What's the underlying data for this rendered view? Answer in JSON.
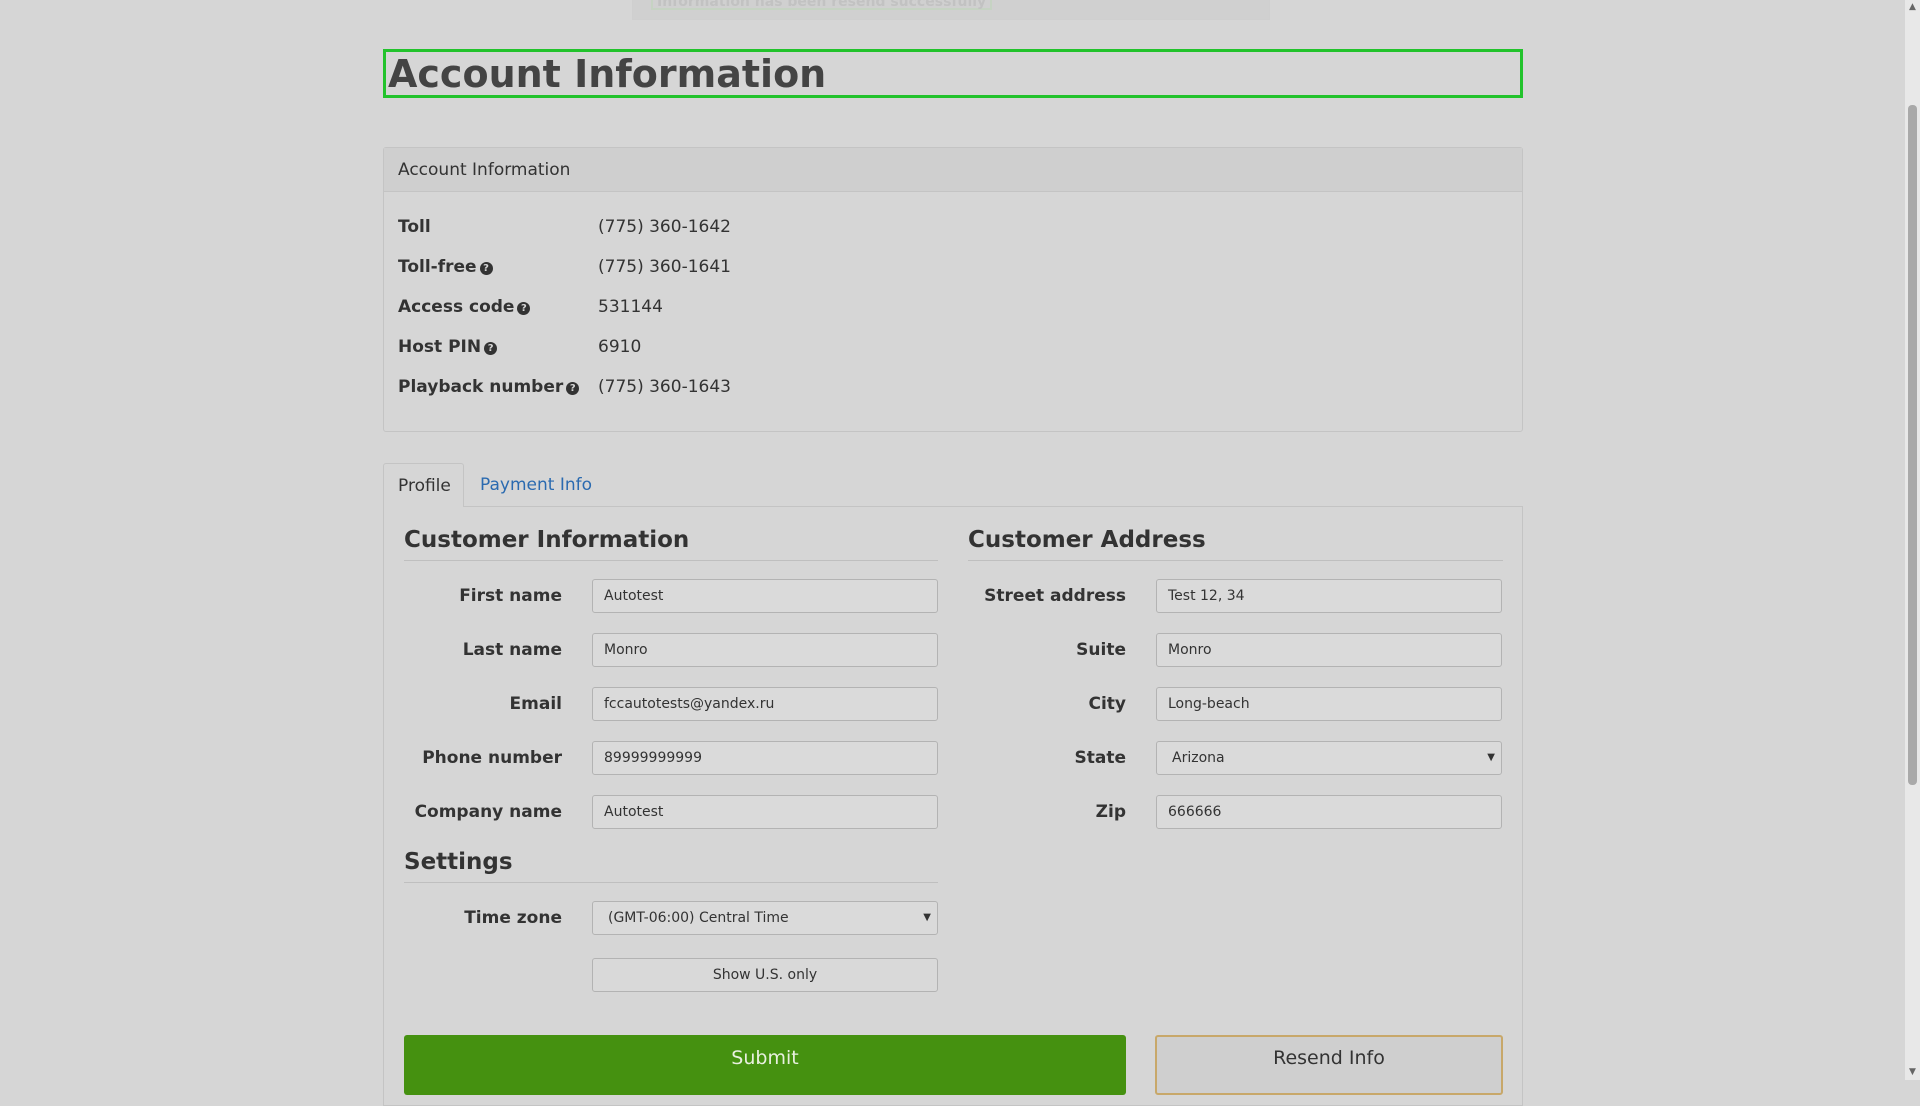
{
  "notification": {
    "text": "Information has been resend successfully"
  },
  "page_title": "Account Information",
  "account_panel": {
    "heading": "Account Information",
    "rows": [
      {
        "label": "Toll",
        "value": "(775) 360-1642",
        "help": false
      },
      {
        "label": "Toll-free",
        "value": "(775) 360-1641",
        "help": true
      },
      {
        "label": "Access code",
        "value": "531144",
        "help": true
      },
      {
        "label": "Host PIN",
        "value": "6910",
        "help": true
      },
      {
        "label": "Playback number",
        "value": "(775) 360-1643",
        "help": true
      }
    ],
    "help_icon": "question-circle-icon"
  },
  "tabs": [
    {
      "label": "Profile",
      "active": true
    },
    {
      "label": "Payment Info",
      "active": false
    }
  ],
  "customer_info": {
    "title": "Customer Information",
    "fields": [
      {
        "label": "First name",
        "value": "Autotest"
      },
      {
        "label": "Last name",
        "value": "Monro"
      },
      {
        "label": "Email",
        "value": "fccautotests@yandex.ru"
      },
      {
        "label": "Phone number",
        "value": "89999999999"
      },
      {
        "label": "Company name",
        "value": "Autotest"
      }
    ]
  },
  "customer_address": {
    "title": "Customer Address",
    "fields": [
      {
        "label": "Street address",
        "value": "Test 12, 34"
      },
      {
        "label": "Suite",
        "value": "Monro"
      },
      {
        "label": "City",
        "value": "Long-beach"
      },
      {
        "label": "State",
        "value": "Arizona",
        "type": "select"
      },
      {
        "label": "Zip",
        "value": "666666"
      }
    ]
  },
  "settings": {
    "title": "Settings",
    "timezone_label": "Time zone",
    "timezone_value": "(GMT-06:00) Central Time",
    "show_us_button": "Show U.S. only"
  },
  "actions": {
    "submit": "Submit",
    "resend": "Resend Info"
  },
  "colors": {
    "accent_green": "#459110",
    "title_outline": "#22c32c",
    "link_blue": "#2a6ab0",
    "resend_border": "#c8a86a",
    "background": "#d6d6d6"
  }
}
